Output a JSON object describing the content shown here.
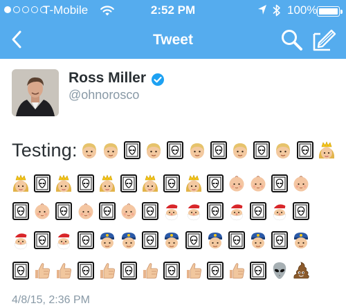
{
  "status_bar": {
    "carrier": "T-Mobile",
    "time": "2:52 PM",
    "battery": "100%",
    "signal_filled": 1,
    "signal_total": 5
  },
  "nav": {
    "title": "Tweet",
    "back_icon": "chevron-left-icon",
    "search_icon": "search-icon",
    "compose_icon": "compose-icon"
  },
  "tweet": {
    "name": "Ross Miller",
    "handle": "@ohnorosco",
    "verified": true,
    "text_prefix": "Testing:",
    "emoji_rows": [
      [
        "boy",
        "boy",
        "alien-box",
        "boy",
        "alien-box",
        "boy",
        "alien-box",
        "boy",
        "alien-box",
        "boy",
        "alien-box",
        "princess"
      ],
      [
        "princess",
        "alien-box",
        "princess",
        "alien-box",
        "princess",
        "alien-box",
        "princess",
        "alien-box",
        "princess",
        "alien-box",
        "baby",
        "baby",
        "alien-box",
        "baby"
      ],
      [
        "alien-box",
        "baby",
        "alien-box",
        "baby",
        "alien-box",
        "baby",
        "alien-box",
        "santa",
        "santa",
        "alien-box",
        "santa",
        "alien-box",
        "santa",
        "alien-box"
      ],
      [
        "santa",
        "alien-box",
        "santa",
        "alien-box",
        "police",
        "police",
        "alien-box",
        "police",
        "alien-box",
        "police",
        "alien-box",
        "police",
        "alien-box",
        "police"
      ],
      [
        "alien-box",
        "thumbs-up",
        "thumbs-up",
        "alien-box",
        "thumbs-up",
        "alien-box",
        "thumbs-up",
        "alien-box",
        "thumbs-up",
        "alien-box",
        "thumbs-up",
        "alien-box",
        "alien",
        "poo"
      ]
    ],
    "timestamp": "4/8/15, 2:36 PM"
  },
  "colors": {
    "bar": "#55acee",
    "name": "#292f33",
    "handle": "#8899a6",
    "verified": "#1da1f2"
  }
}
